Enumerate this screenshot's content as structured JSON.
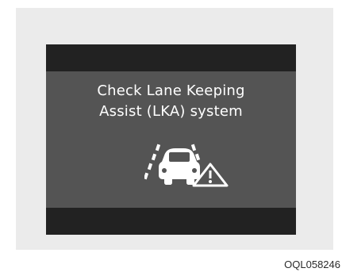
{
  "display": {
    "message_line_1": "Check Lane Keeping",
    "message_line_2": "Assist (LKA) system",
    "icon": "lane-keeping-assist-warning-icon"
  },
  "figure": {
    "code": "OQL058246"
  },
  "colors": {
    "page_background": "#ffffff",
    "panel_background": "#ebebeb",
    "display_background": "#545454",
    "band_background": "#222222",
    "text": "#ffffff"
  }
}
